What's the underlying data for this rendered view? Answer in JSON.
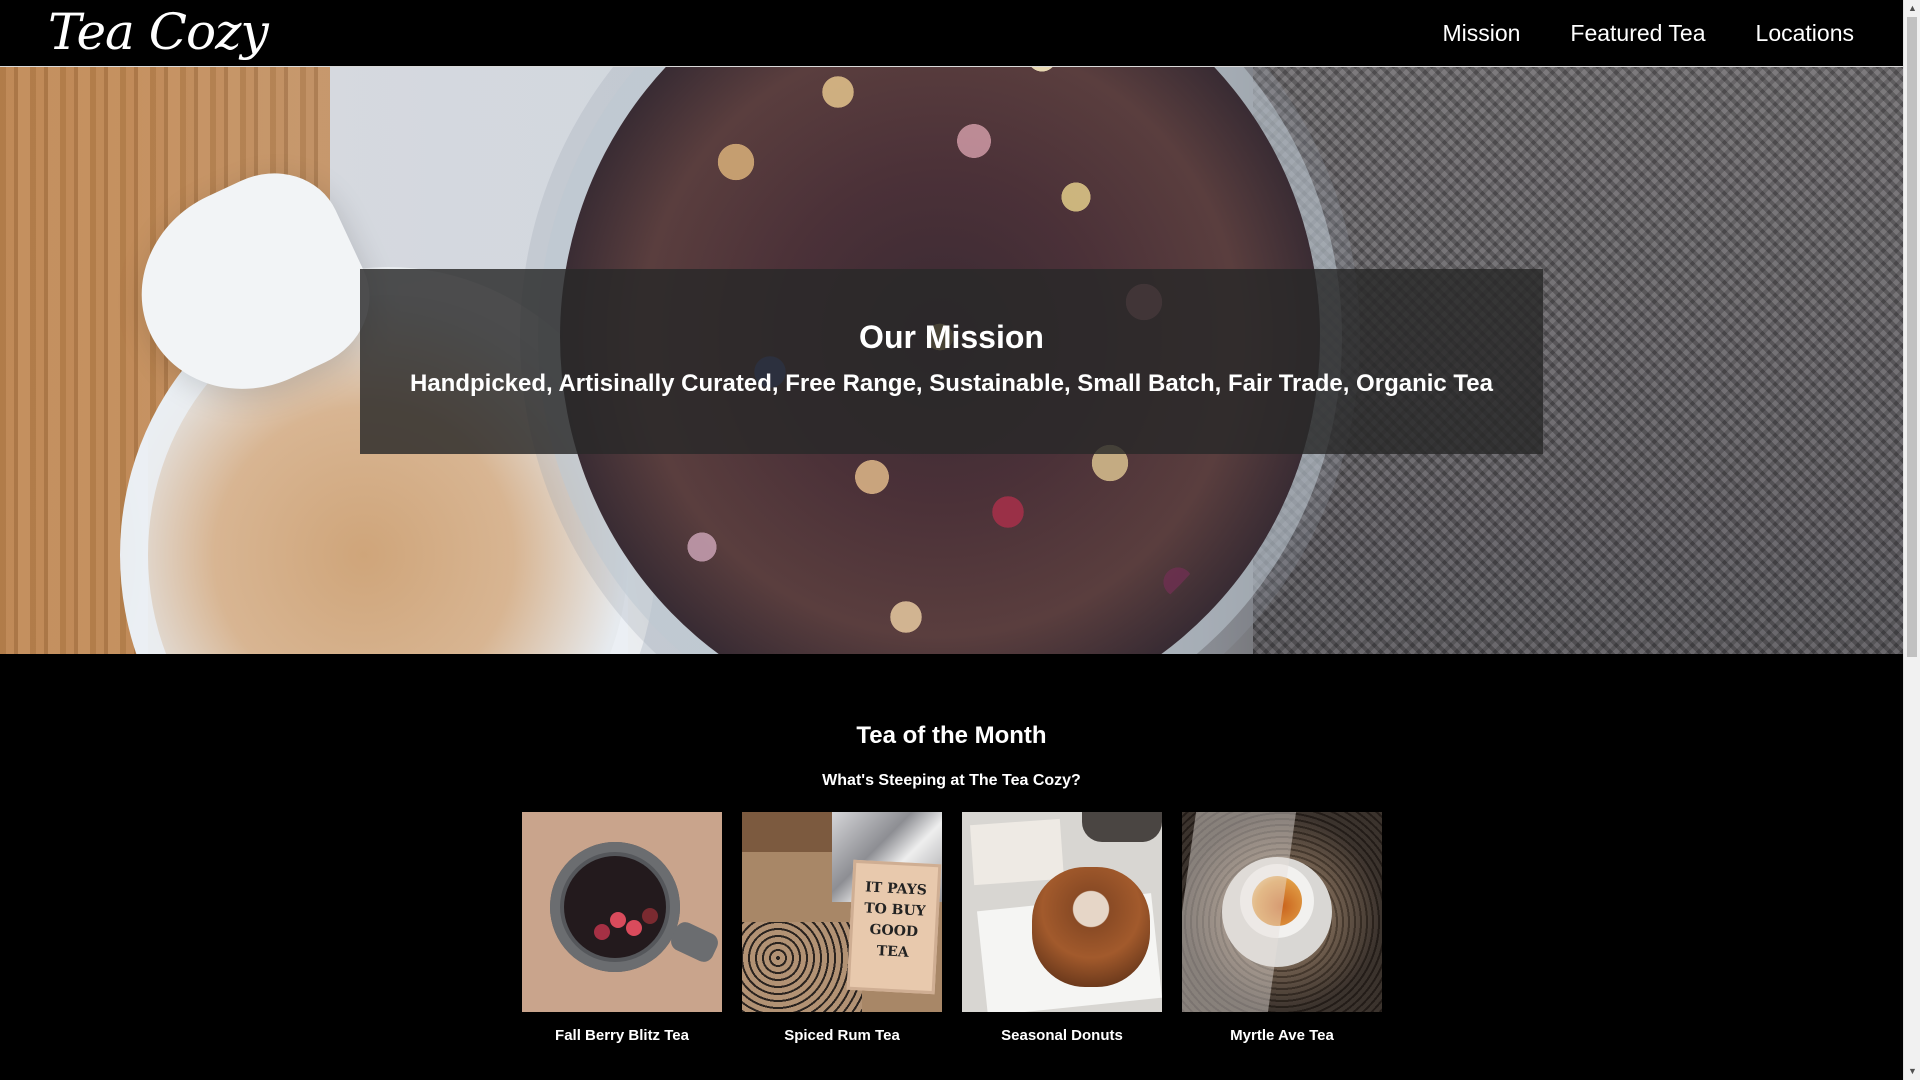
{
  "header": {
    "logo": "Tea Cozy",
    "nav": [
      "Mission",
      "Featured Tea",
      "Locations"
    ]
  },
  "hero": {
    "title": "Our Mission",
    "text": "Handpicked, Artisinally Curated, Free Range, Sustainable, Small Batch, Fair Trade, Organic Tea"
  },
  "featured": {
    "title": "Tea of the Month",
    "subtitle": "What's Steeping at The Tea Cozy?",
    "items": [
      {
        "caption": "Fall Berry Blitz Tea"
      },
      {
        "caption": "Spiced Rum Tea"
      },
      {
        "caption": "Seasonal Donuts"
      },
      {
        "caption": "Myrtle Ave Tea"
      }
    ],
    "sign_text": "IT PAYS TO BUY GOOD TEA"
  },
  "colors": {
    "background": "#000000",
    "text": "#ffffff",
    "overlay": "rgba(40,40,40,0.82)"
  },
  "icons": {
    "scroll_up": "triangle-up-icon",
    "scroll_down": "triangle-down-icon"
  }
}
